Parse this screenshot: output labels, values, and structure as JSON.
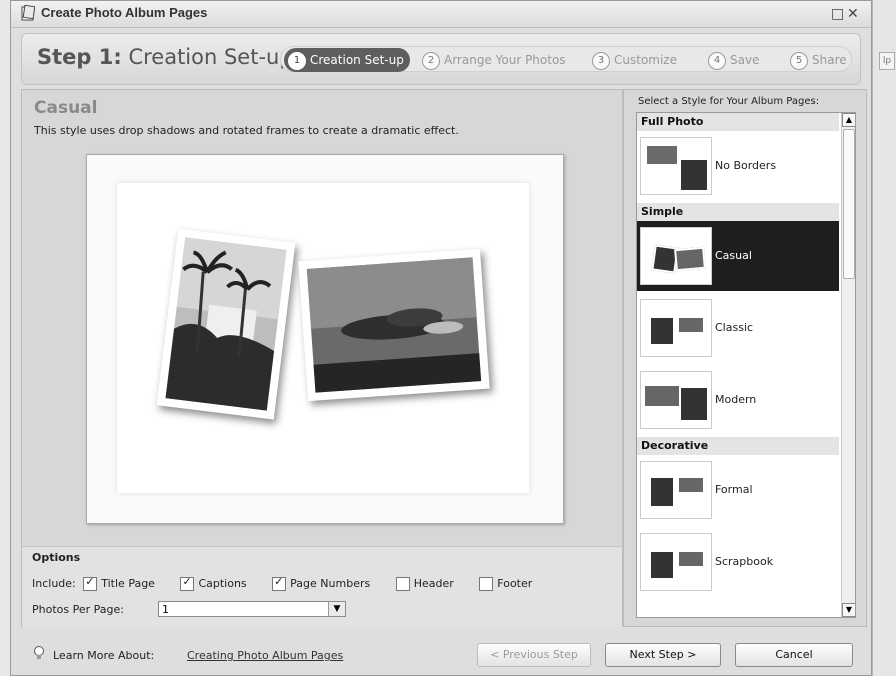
{
  "window": {
    "title": "Create Photo Album Pages",
    "restore_icon": "□",
    "close_icon": "✕"
  },
  "stepbar": {
    "label": "Step 1:",
    "title": "Creation Set-up",
    "steps": [
      {
        "num": "1",
        "label": "Creation Set-up",
        "active": true
      },
      {
        "num": "2",
        "label": "Arrange Your Photos",
        "active": false
      },
      {
        "num": "3",
        "label": "Customize",
        "active": false
      },
      {
        "num": "4",
        "label": "Save",
        "active": false
      },
      {
        "num": "5",
        "label": "Share",
        "active": false
      }
    ]
  },
  "preview": {
    "style_name": "Casual",
    "description": "This style uses drop shadows and rotated frames to create a dramatic effect."
  },
  "options": {
    "title": "Options",
    "include_label": "Include:",
    "checkboxes": [
      {
        "label": "Title Page",
        "checked": true
      },
      {
        "label": "Captions",
        "checked": true
      },
      {
        "label": "Page Numbers",
        "checked": true
      },
      {
        "label": "Header",
        "checked": false
      },
      {
        "label": "Footer",
        "checked": false
      }
    ],
    "photos_per_page_label": "Photos Per Page:",
    "photos_per_page_value": "1"
  },
  "styles_panel": {
    "label": "Select a Style for Your Album Pages:",
    "groups": [
      "Full Photo",
      "Simple",
      "Decorative"
    ],
    "items": [
      {
        "label": "No Borders",
        "selected": false
      },
      {
        "label": "Casual",
        "selected": true
      },
      {
        "label": "Classic",
        "selected": false
      },
      {
        "label": "Modern",
        "selected": false
      },
      {
        "label": "Formal",
        "selected": false
      },
      {
        "label": "Scrapbook",
        "selected": false
      }
    ]
  },
  "footer": {
    "learn_label": "Learn More About:",
    "learn_link": "Creating Photo Album Pages",
    "prev_button": "< Previous Step",
    "next_button": "Next Step >",
    "cancel_button": "Cancel"
  },
  "background_app": {
    "edge_text": "lp"
  }
}
